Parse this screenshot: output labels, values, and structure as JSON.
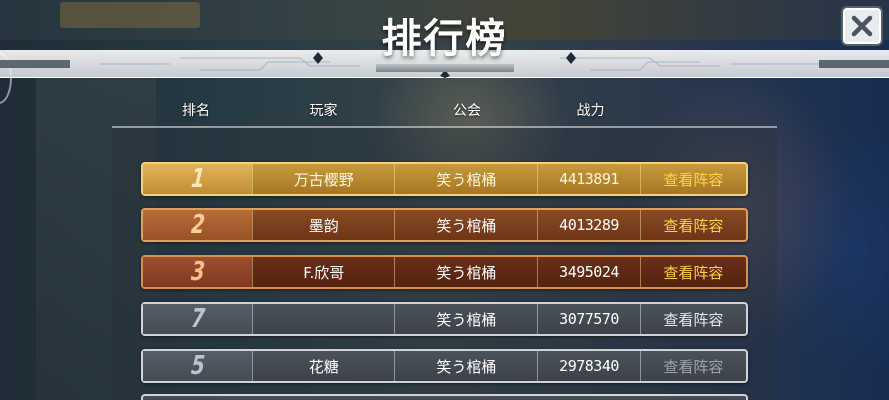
{
  "title": "排行榜",
  "columns": {
    "rank": "排名",
    "player": "玩家",
    "guild": "公会",
    "power": "战力"
  },
  "rows": [
    {
      "rank": "1",
      "player": "万古樱野",
      "guild": "笑う棺桶",
      "power": "4413891",
      "action": "查看阵容"
    },
    {
      "rank": "2",
      "player": "墨韵",
      "guild": "笑う棺桶",
      "power": "4013289",
      "action": "查看阵容"
    },
    {
      "rank": "3",
      "player": "F.欣哥",
      "guild": "笑う棺桶",
      "power": "3495024",
      "action": "查看阵容"
    },
    {
      "rank": "7",
      "player": "",
      "guild": "笑う棺桶",
      "power": "3077570",
      "action": "查看阵容"
    },
    {
      "rank": "5",
      "player": "花糖",
      "guild": "笑う棺桶",
      "power": "2978340",
      "action": "查看阵容"
    }
  ],
  "colors": {
    "gold": "#c79a3d",
    "orange": "#8a4a24",
    "rust": "#6a2f1a",
    "gray": "#4c525a",
    "action_highlight": "#ffd24a"
  },
  "icons": {
    "close": "close-icon"
  }
}
